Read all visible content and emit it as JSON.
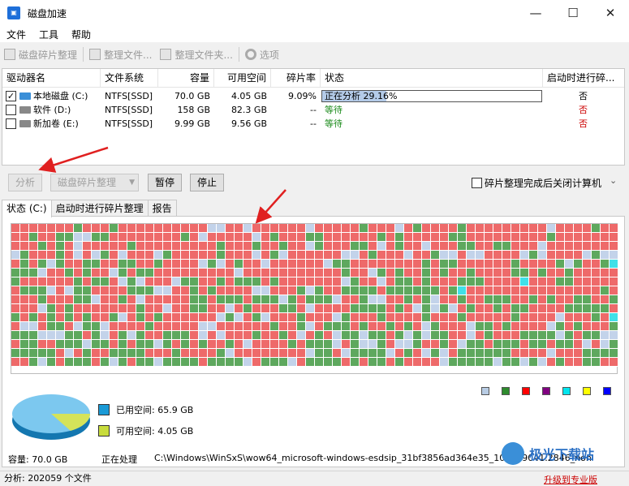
{
  "window": {
    "title": "磁盘加速",
    "minimize": "—",
    "maximize": "☐",
    "close": "✕"
  },
  "menu": [
    "文件",
    "工具",
    "帮助"
  ],
  "toolbar": {
    "defrag": "磁盘碎片整理",
    "defrag_files": "整理文件...",
    "defrag_folder": "整理文件夹...",
    "options": "选项"
  },
  "table": {
    "headers": [
      "驱动器名",
      "文件系统",
      "容量",
      "可用空间",
      "碎片率",
      "状态",
      "启动时进行碎..."
    ],
    "rows": [
      {
        "checked": true,
        "name": "本地磁盘 (C:)",
        "fs": "NTFS[SSD]",
        "capacity": "70.0 GB",
        "free": "4.05 GB",
        "frag": "9.09%",
        "status": "正在分析 29.16%",
        "progress": 29.16,
        "boot": "否"
      },
      {
        "checked": false,
        "name": "软件 (D:)",
        "fs": "NTFS[SSD]",
        "capacity": "158 GB",
        "free": "82.3 GB",
        "frag": "--",
        "status": "等待",
        "boot": "否"
      },
      {
        "checked": false,
        "name": "新加卷 (E:)",
        "fs": "NTFS[SSD]",
        "capacity": "9.99 GB",
        "free": "9.56 GB",
        "frag": "--",
        "status": "等待",
        "boot": "否"
      }
    ]
  },
  "actions": {
    "analyze": "分析",
    "defrag": "磁盘碎片整理",
    "pause": "暂停",
    "stop": "停止",
    "shutdown_label": "碎片整理完成后关闭计算机"
  },
  "tabs": [
    "状态 (C:)",
    "启动时进行碎片整理",
    "报告"
  ],
  "legend_colors": [
    "#b8cce4",
    "#2e8b2e",
    "#ff0000",
    "#800080",
    "#00e5ee",
    "#ffff00",
    "#0000ff"
  ],
  "cluster_colors": {
    "red": "#ee6a6a",
    "green": "#5ea85e",
    "blue": "#c3d3ea",
    "cyan": "#40e0e8"
  },
  "usage": {
    "used_label": "已用空间: 65.9 GB",
    "used_color": "#1a9ad6",
    "free_label": "可用空间: 4.05 GB",
    "free_color": "#c8dc3c"
  },
  "info": {
    "capacity": "容量: 70.0 GB",
    "processing_label": "正在处理",
    "path": "C:\\Windows\\WinSxS\\wow64_microsoft-windows-esdsip_31bf3856ad364e35_10.0.19041.2846_none_4...\\EsdSip.dll"
  },
  "statusbar": {
    "text": "分析: 202059 个文件",
    "upgrade": "升级到专业版"
  },
  "watermark": "极光下载站"
}
